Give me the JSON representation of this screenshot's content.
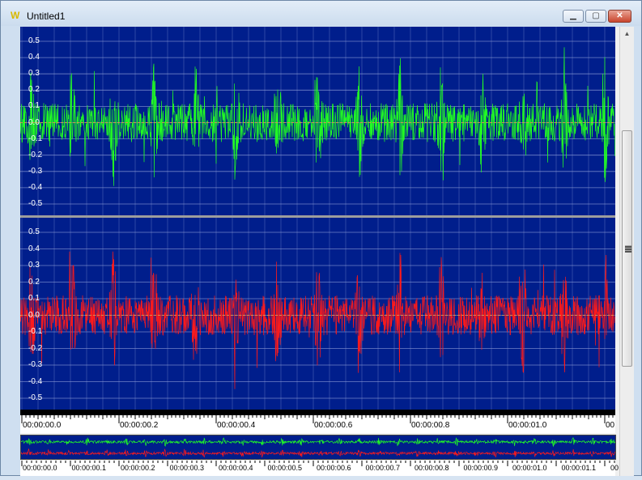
{
  "window": {
    "title": "Untitled1",
    "app_icon": "W"
  },
  "controls": {
    "minimize": "▁",
    "maximize": "▢",
    "close": "✕"
  },
  "top_channel": {
    "color": "#22ff22",
    "y_labels": [
      "0.5",
      "0.4",
      "0.3",
      "0.2",
      "0.1",
      "0.0",
      "-0.1",
      "-0.2",
      "-0.3",
      "-0.4",
      "-0.5"
    ]
  },
  "bottom_channel": {
    "color": "#ff1a1a",
    "y_labels": [
      "0.5",
      "0.4",
      "0.3",
      "0.2",
      "0.1",
      "0.0",
      "-0.1",
      "-0.2",
      "-0.3",
      "-0.4",
      "-0.5"
    ]
  },
  "timeline": {
    "labels": [
      "00:00:00.0",
      "00:00:00.2",
      "00:00:00.4",
      "00:00:00.6",
      "00:00:00.8",
      "00:00:01.0",
      "00"
    ]
  },
  "overview_timeline": {
    "labels": [
      "00:00:00.0",
      "00:00:00.1",
      "00:00:00.2",
      "00:00:00.3",
      "00:00:00.4",
      "00:00:00.5",
      "00:00:00.6",
      "00:00:00.7",
      "00:00:00.8",
      "00:00:00.9",
      "00:00:01.0",
      "00:00:01.1",
      "00"
    ]
  },
  "colors": {
    "plot_bg": "#001e8c",
    "grid": "#8c9bd6",
    "center_line": "#d09050"
  }
}
